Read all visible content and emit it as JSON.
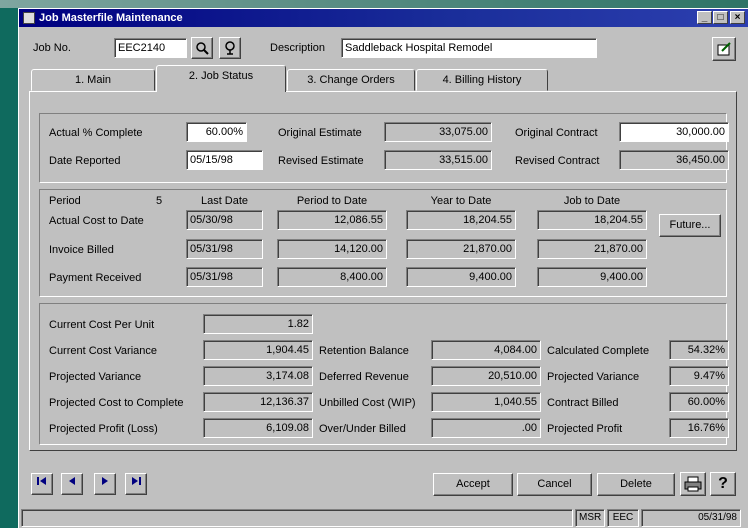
{
  "window": {
    "title": "Job Masterfile Maintenance"
  },
  "header": {
    "job_no_label": "Job No.",
    "job_no": "EEC2140",
    "description_label": "Description",
    "description": "Saddleback Hospital Remodel"
  },
  "tabs": [
    {
      "label": "1. Main"
    },
    {
      "label": "2. Job Status"
    },
    {
      "label": "3. Change Orders"
    },
    {
      "label": "4. Billing History"
    }
  ],
  "status_box": {
    "actual_pct_label": "Actual % Complete",
    "actual_pct": "60.00%",
    "date_reported_label": "Date Reported",
    "date_reported": "05/15/98",
    "orig_estimate_label": "Original Estimate",
    "orig_estimate": "33,075.00",
    "rev_estimate_label": "Revised Estimate",
    "rev_estimate": "33,515.00",
    "orig_contract_label": "Original Contract",
    "orig_contract": "30,000.00",
    "rev_contract_label": "Revised Contract",
    "rev_contract": "36,450.00"
  },
  "period_box": {
    "period_label": "Period",
    "period_value": "5",
    "col_headers": [
      "Last Date",
      "Period to Date",
      "Year to Date",
      "Job to Date"
    ],
    "rows": [
      {
        "label": "Actual Cost to Date",
        "values": [
          "05/30/98",
          "12,086.55",
          "18,204.55",
          "18,204.55"
        ]
      },
      {
        "label": "Invoice Billed",
        "values": [
          "05/31/98",
          "14,120.00",
          "21,870.00",
          "21,870.00"
        ]
      },
      {
        "label": "Payment Received",
        "values": [
          "05/31/98",
          "8,400.00",
          "9,400.00",
          "9,400.00"
        ]
      }
    ],
    "future_button": "Future..."
  },
  "summary_box": {
    "col1": [
      {
        "label": "Current Cost Per Unit",
        "value": "1.82"
      },
      {
        "label": "Current Cost Variance",
        "value": "1,904.45"
      },
      {
        "label": "Projected Variance",
        "value": "3,174.08"
      },
      {
        "label": "Projected Cost to Complete",
        "value": "12,136.37"
      },
      {
        "label": "Projected Profit (Loss)",
        "value": "6,109.08"
      }
    ],
    "col2": [
      {
        "label": "Retention Balance",
        "value": "4,084.00"
      },
      {
        "label": "Deferred Revenue",
        "value": "20,510.00"
      },
      {
        "label": "Unbilled Cost (WIP)",
        "value": "1,040.55"
      },
      {
        "label": "Over/Under Billed",
        "value": ".00"
      }
    ],
    "col3": [
      {
        "label": "Calculated Complete",
        "value": "54.32%"
      },
      {
        "label": "Projected Variance",
        "value": "9.47%"
      },
      {
        "label": "Contract Billed",
        "value": "60.00%"
      },
      {
        "label": "Projected Profit",
        "value": "16.76%"
      }
    ]
  },
  "buttons": {
    "accept": "Accept",
    "cancel": "Cancel",
    "delete": "Delete",
    "help": "?"
  },
  "statusbar": {
    "user": "MSR",
    "company": "EEC",
    "date": "05/31/98"
  },
  "icons": {
    "search": "magnifier-icon",
    "lookup": "lookup-icon",
    "print": "printer-icon"
  }
}
